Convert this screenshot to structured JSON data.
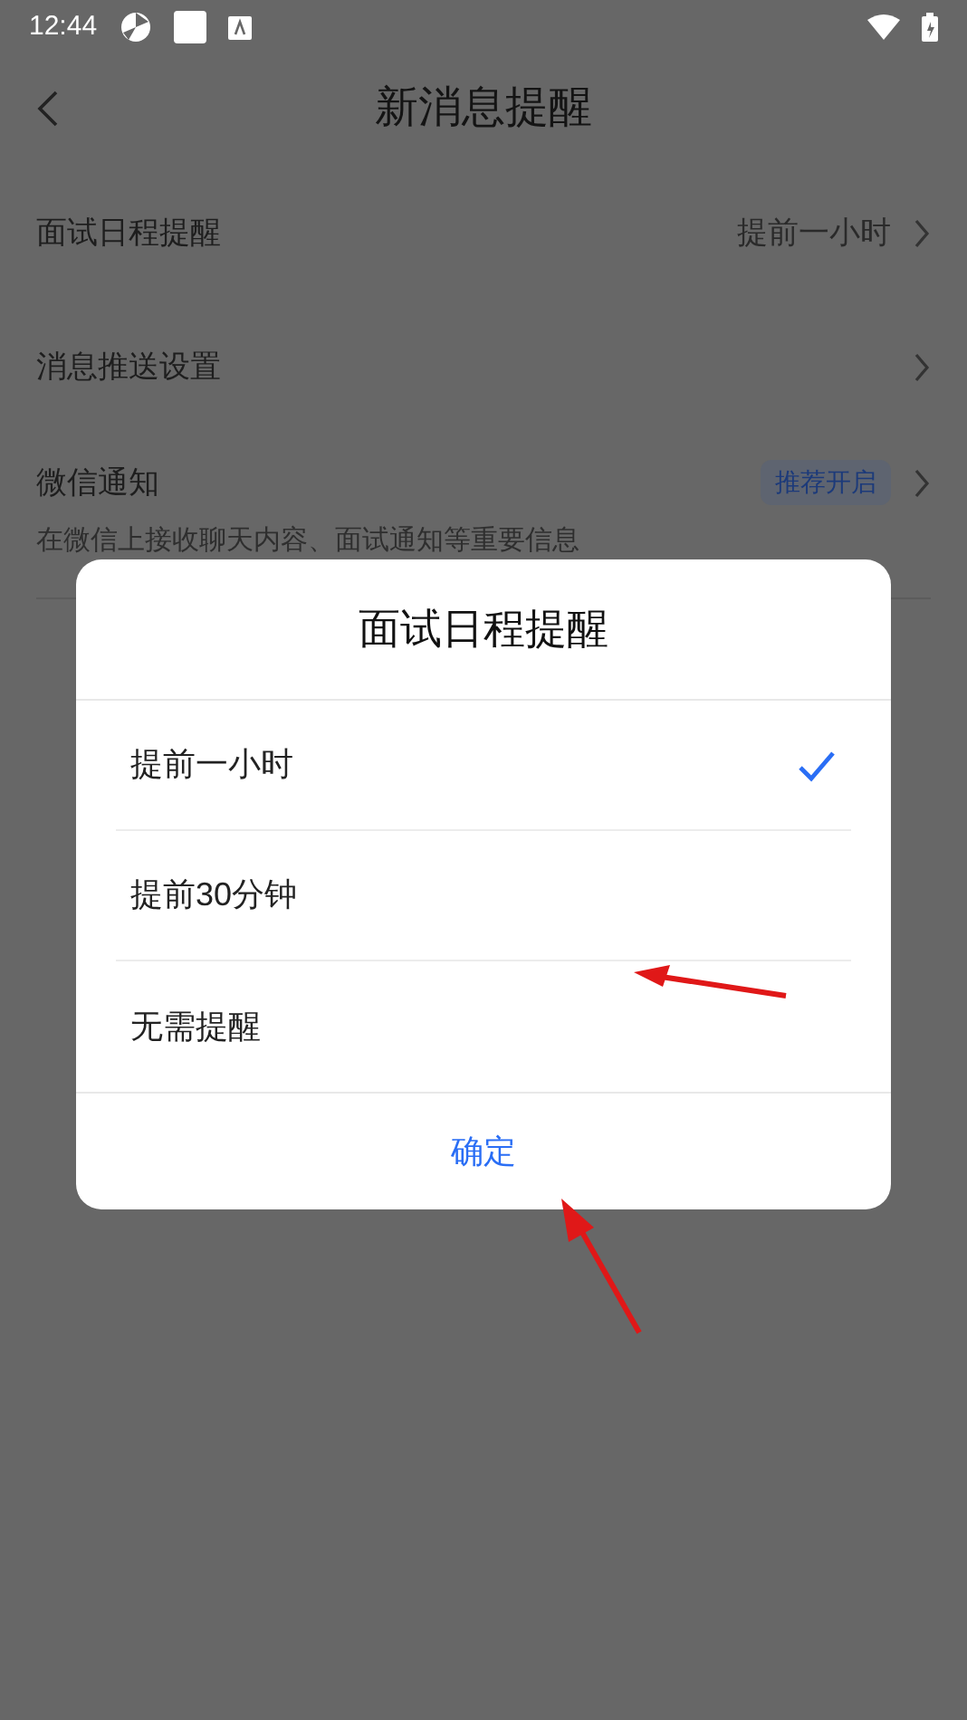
{
  "status_bar": {
    "time": "12:44"
  },
  "header": {
    "title": "新消息提醒"
  },
  "settings": [
    {
      "kind": "value",
      "label": "面试日程提醒",
      "value": "提前一小时"
    },
    {
      "kind": "plain",
      "label": "消息推送设置"
    },
    {
      "kind": "badge",
      "label": "微信通知",
      "badge": "推荐开启",
      "description": "在微信上接收聊天内容、面试通知等重要信息"
    }
  ],
  "dialog": {
    "title": "面试日程提醒",
    "options": [
      {
        "label": "提前一小时",
        "selected": true
      },
      {
        "label": "提前30分钟",
        "selected": false
      },
      {
        "label": "无需提醒",
        "selected": false
      }
    ],
    "confirm": "确定"
  }
}
